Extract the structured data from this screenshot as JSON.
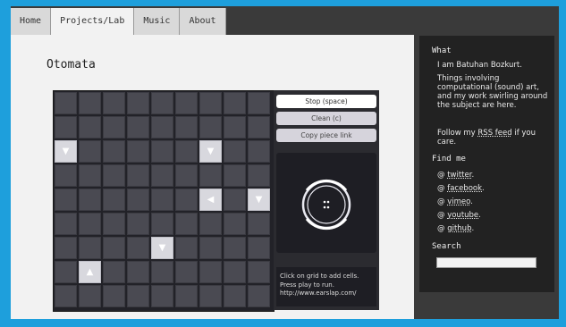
{
  "nav": {
    "tabs": [
      {
        "label": "Home"
      },
      {
        "label": "Projects/Lab"
      },
      {
        "label": "Music"
      },
      {
        "label": "About"
      }
    ],
    "active": "Projects/Lab"
  },
  "page": {
    "title": "Otomata"
  },
  "grid": {
    "rows": 9,
    "cols": 9,
    "pieces": [
      {
        "row": 2,
        "col": 0,
        "arrow": "▼",
        "dir": "down"
      },
      {
        "row": 2,
        "col": 6,
        "arrow": "▼",
        "dir": "down"
      },
      {
        "row": 4,
        "col": 6,
        "arrow": "◀",
        "dir": "left"
      },
      {
        "row": 4,
        "col": 8,
        "arrow": "▼",
        "dir": "down"
      },
      {
        "row": 6,
        "col": 4,
        "arrow": "▼",
        "dir": "down"
      },
      {
        "row": 7,
        "col": 1,
        "arrow": "▲",
        "dir": "up"
      }
    ]
  },
  "controls": {
    "stop_label": "Stop (space)",
    "clean_label": "Clean (c)",
    "copy_label": "Copy piece link",
    "info_lines": [
      "Click on grid to add cells.",
      "Press play to run.",
      "http://www.earslap.com/"
    ]
  },
  "sidebar": {
    "what_heading": "What",
    "what_intro": "I am Batuhan Bozkurt.",
    "what_desc": "Things involving computational (sound) art, and my work swirling around the subject are here.",
    "rss_prefix": "Follow my ",
    "rss_link": "RSS feed",
    "rss_suffix": " if you care.",
    "find_heading": "Find me",
    "links": [
      {
        "label": "twitter",
        "suffix": "."
      },
      {
        "label": "facebook",
        "suffix": "."
      },
      {
        "label": "vimeo",
        "suffix": "."
      },
      {
        "label": "youtube",
        "suffix": "."
      },
      {
        "label": "github",
        "suffix": "."
      }
    ],
    "at_symbol": "@",
    "search_heading": "Search",
    "search_placeholder": ""
  },
  "colors": {
    "background": "#1e9fdc",
    "sidebar": "#222222",
    "grid_cell": "#4a4a52",
    "piece": "#d8d8de"
  }
}
